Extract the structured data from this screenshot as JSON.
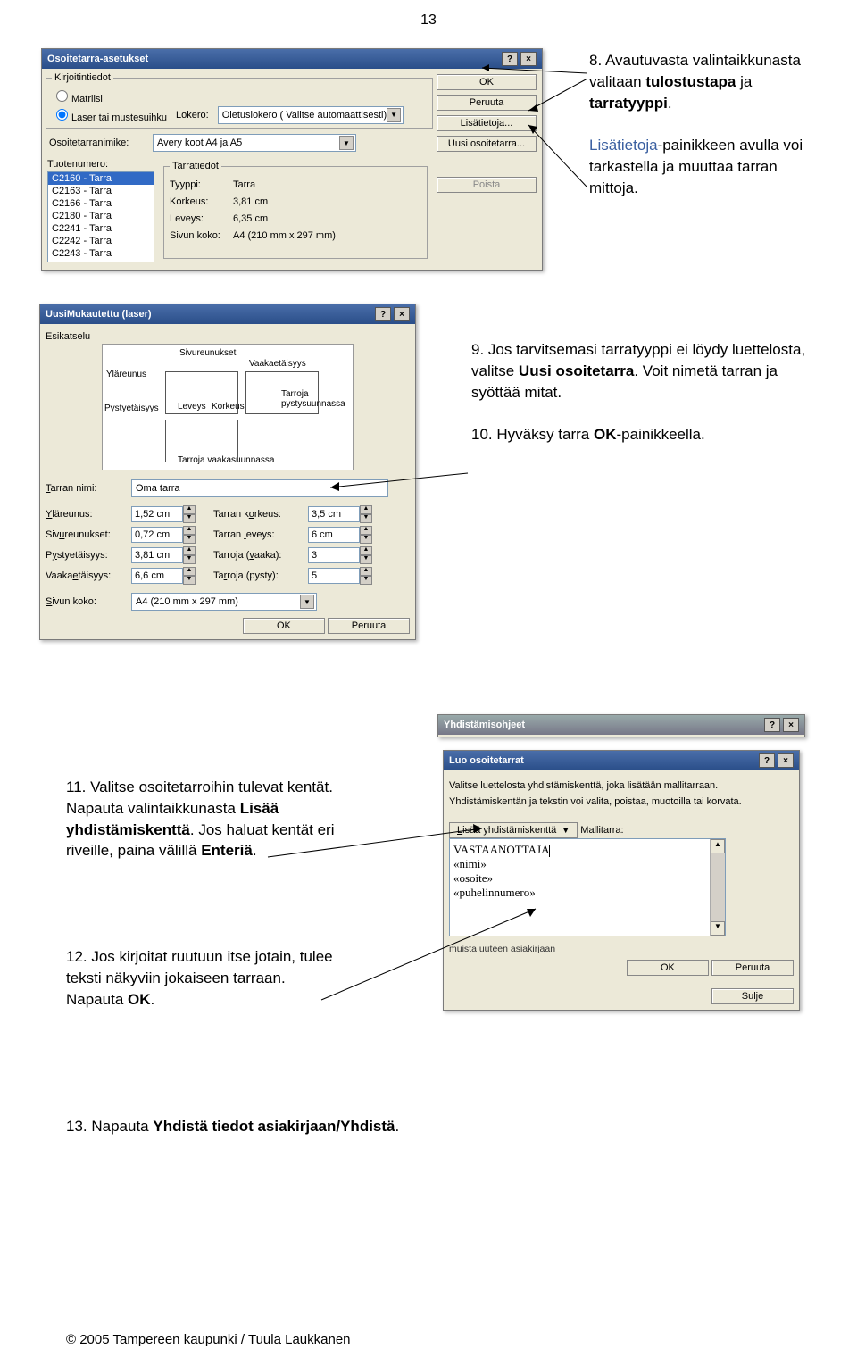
{
  "page_number": "13",
  "dialog1": {
    "title": "Osoitetarra-asetukset",
    "group_printer_legend": "Kirjoitintiedot",
    "radio_matrix": "Matriisi",
    "radio_laser": "Laser tai mustesuihku",
    "tray_label": "Lokero:",
    "tray_value": "Oletuslokero ( Valitse automaattisesti)",
    "label_label": "Osoitetarranimike:",
    "label_value": "Avery koot A4 ja A5",
    "product_label": "Tuotenumero:",
    "products": [
      "C2160 - Tarra",
      "C2163 - Tarra",
      "C2166 - Tarra",
      "C2180 - Tarra",
      "C2241 - Tarra",
      "C2242 - Tarra",
      "C2243 - Tarra"
    ],
    "details_legend": "Tarratiedot",
    "type_label": "Tyyppi:",
    "type_value": "Tarra",
    "height_label": "Korkeus:",
    "height_value": "3,81 cm",
    "width_label": "Leveys:",
    "width_value": "6,35 cm",
    "pagesize_label": "Sivun koko:",
    "pagesize_value": "A4 (210 mm x 297 mm)",
    "btn_ok": "OK",
    "btn_cancel": "Peruuta",
    "btn_details": "Lisätietoja...",
    "btn_new": "Uusi osoitetarra...",
    "btn_delete": "Poista"
  },
  "dialog2": {
    "title": "UusiMukautettu (laser)",
    "preview_legend": "Esikatselu",
    "lbl_side": "Sivureunukset",
    "lbl_top": "Yläreunus",
    "lbl_vpitch": "Pystyetäisyys",
    "lbl_hpitch": "Vaakaetäisyys",
    "lbl_width": "Leveys",
    "lbl_height": "Korkeus",
    "lbl_across": "Tarroja vaakasuunnassa",
    "lbl_down": "Tarroja pystysuunnassa",
    "name_label": "Tarran nimi:",
    "name_value": "Oma tarra",
    "top_margin_label": "Yläreunus:",
    "top_margin_value": "1,52 cm",
    "side_margin_label": "Sivureunukset:",
    "side_margin_value": "0,72 cm",
    "vpitch_label": "Pystyetäisyys:",
    "vpitch_value": "3,81 cm",
    "hpitch_label": "Vaakaetäisyys:",
    "hpitch_value": "6,6 cm",
    "lblheight_label": "Tarran korkeus:",
    "lblheight_value": "3,5 cm",
    "lblwidth_label": "Tarran leveys:",
    "lblwidth_value": "6 cm",
    "across_label": "Tarroja (vaaka):",
    "across_value": "3",
    "down_label": "Tarroja (pysty):",
    "down_value": "5",
    "pagesize_label": "Sivun koko:",
    "pagesize_value": "A4 (210 mm x 297 mm)",
    "btn_ok": "OK",
    "btn_cancel": "Peruuta"
  },
  "dialog_merge_instr": {
    "title": "Yhdistämisohjeet"
  },
  "dialog3": {
    "title": "Luo osoitetarrat",
    "instr1": "Valitse luettelosta yhdistämiskenttä, joka lisätään mallitarraan.",
    "instr2": "Yhdistämiskentän ja tekstin voi valita, poistaa, muotoilla tai korvata.",
    "btn_insert": "Lisää yhdistämiskenttä",
    "sample_label": "Mallitarra:",
    "line1": "VASTAANOTTAJA",
    "line2": "«nimi»",
    "line3": "«osoite»",
    "line4": "«puhelinnumero»",
    "small_line": "muista uuteen asiakirjaan",
    "btn_ok": "OK",
    "btn_cancel": "Peruuta",
    "btn_close": "Sulje"
  },
  "notes": {
    "n8": "8. Avautuvasta valintaikkunasta valitaan ",
    "n8b1": "tulostustapa",
    "n8mid": " ja ",
    "n8b2": "tarratyyppi",
    "n8end": ".",
    "n8p2a": "Lisätietoja",
    "n8p2b": "-painikkeen avulla voi tarkastella ja muuttaa tarran mittoja.",
    "n9a": "9. Jos tarvitsemasi tarratyyppi ei löydy luettelosta, valitse ",
    "n9b": "Uusi osoitetarra",
    "n9c": ". Voit nimetä tarran ja syöttää mitat.",
    "n10a": "10. Hyväksy tarra ",
    "n10b": "OK",
    "n10c": "-painikkeella.",
    "n11a": "11. Valitse osoitetarroihin tulevat kentät. Napauta valintaikkunasta ",
    "n11b": "Lisää yhdistämiskenttä",
    "n11c": ". Jos haluat kentät eri riveille, paina välillä ",
    "n11d": "Enteriä",
    "n11e": ".",
    "n12a": "12. Jos kirjoitat ruutuun itse jotain, tulee teksti näkyviin jokaiseen tarraan. Napauta ",
    "n12b": "OK",
    "n12c": ".",
    "n13a": "13. Napauta ",
    "n13b": "Yhdistä tiedot asiakirjaan/Yhdistä",
    "n13c": "."
  },
  "footer": "© 2005 Tampereen kaupunki / Tuula Laukkanen"
}
